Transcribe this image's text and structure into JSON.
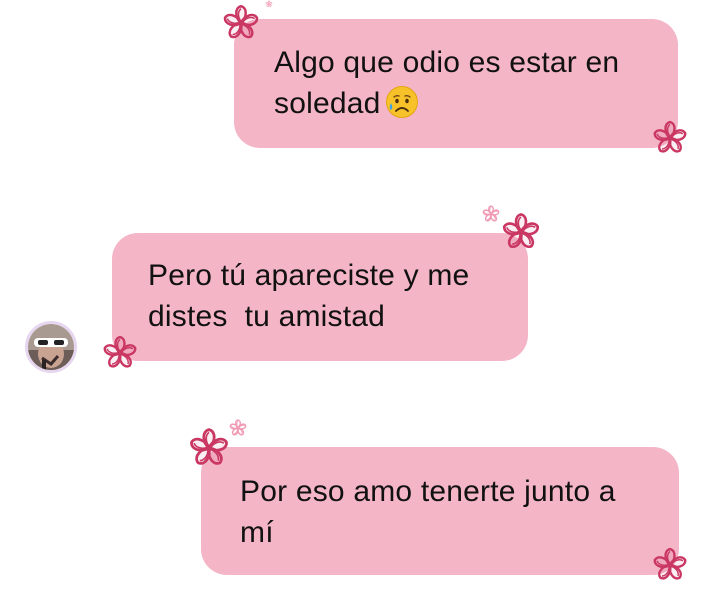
{
  "conversation": {
    "messages": [
      {
        "side": "right",
        "text": "Algo que odio es estar en soledad",
        "emoji": "sad-but-relieved-face"
      },
      {
        "side": "left",
        "text": "Pero tú apareciste y me distes  tu amistad"
      },
      {
        "side": "right",
        "text": "Por eso amo tenerte junto a mí"
      }
    ]
  },
  "theme": {
    "bubble_color": "#f4b5c7",
    "flower_color": "#c93762",
    "sparkle_color": "#f09ab4",
    "text_color": "#111111"
  },
  "icons": [
    "sad-but-relieved-face-emoji",
    "flower-icon",
    "sparkle-flower-icon",
    "avatar"
  ]
}
